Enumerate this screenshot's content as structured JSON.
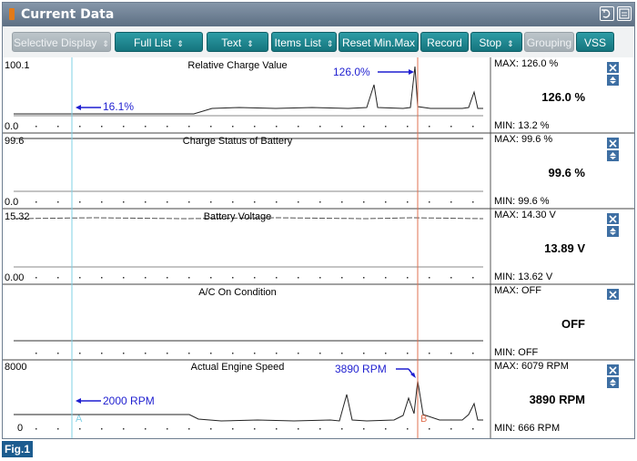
{
  "window": {
    "title": "Current Data"
  },
  "toolbar": {
    "selective_display": "Selective Display",
    "full_list": "Full List",
    "text": "Text",
    "items_list": "Items List",
    "reset_minmax": "Reset Min.Max",
    "record": "Record",
    "stop": "Stop",
    "grouping": "Grouping",
    "vss": "VSS"
  },
  "panels": [
    {
      "name": "Relative Charge Value",
      "ymax": "100.1",
      "ymin": "0.0",
      "max": "MAX: 126.0 %",
      "current": "126.0 %",
      "min": "MIN: 13.2 %"
    },
    {
      "name": "Charge Status of Battery",
      "ymax": "99.6",
      "ymin": "0.0",
      "max": "MAX: 99.6 %",
      "current": "99.6 %",
      "min": "MIN: 99.6 %"
    },
    {
      "name": "Battery Voltage",
      "ymax": "15.32",
      "ymin": "0.00",
      "max": "MAX: 14.30 V",
      "current": "13.89 V",
      "min": "MIN: 13.62 V"
    },
    {
      "name": "A/C On Condition",
      "ymax": "",
      "ymin": "",
      "max": "MAX: OFF",
      "current": "OFF",
      "min": "MIN: OFF"
    },
    {
      "name": "Actual Engine Speed",
      "ymax": "8000",
      "ymin": "0",
      "max": "MAX: 6079 RPM",
      "current": "3890 RPM",
      "min": "MIN:  666 RPM"
    }
  ],
  "annotations": {
    "charge_low": "16.1%",
    "charge_high": "126.0%",
    "rpm_low": "2000 RPM",
    "rpm_high": "3890 RPM",
    "cursor_a": "A",
    "cursor_b": "B"
  },
  "footer": {
    "label": "Fig.1"
  },
  "colors": {
    "accent": "#1a8a93",
    "annotation": "#1f1fd0",
    "cursor_a": "#7fd0e6",
    "cursor_b": "#e07050"
  },
  "icons": [
    "battery-icon",
    "retry-icon",
    "menu-icon",
    "close-icon",
    "updown-icon"
  ]
}
